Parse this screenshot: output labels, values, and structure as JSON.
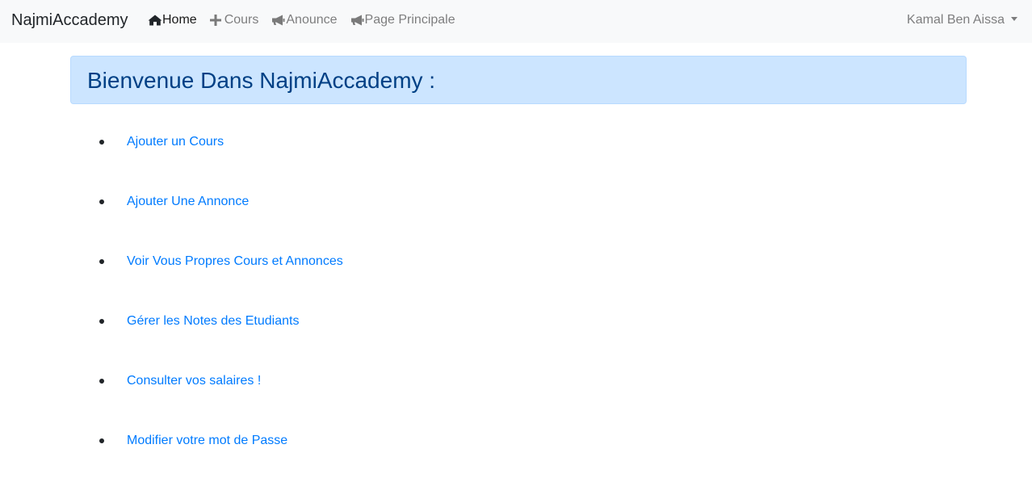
{
  "navbar": {
    "brand": "NajmiAccademy",
    "links": [
      {
        "label": "Home",
        "icon": "home-icon"
      },
      {
        "label": "Cours",
        "icon": "plus-icon"
      },
      {
        "label": "Anounce",
        "icon": "bullhorn-icon"
      },
      {
        "label": "Page Principale",
        "icon": "bullhorn-icon"
      }
    ],
    "user": "Kamal Ben Aissa"
  },
  "banner": {
    "title": "Bienvenue Dans NajmiAccademy :"
  },
  "menu": [
    {
      "label": "Ajouter un Cours"
    },
    {
      "label": "Ajouter Une Annonce"
    },
    {
      "label": "Voir Vous Propres Cours et Annonces"
    },
    {
      "label": "Gérer les Notes des Etudiants"
    },
    {
      "label": "Consulter vos salaires !"
    },
    {
      "label": "Modifier votre mot de Passe"
    }
  ],
  "colors": {
    "link": "#007bff",
    "banner_bg": "#cce5ff",
    "banner_text": "#004085",
    "navbar_bg": "#f8f9fa"
  }
}
